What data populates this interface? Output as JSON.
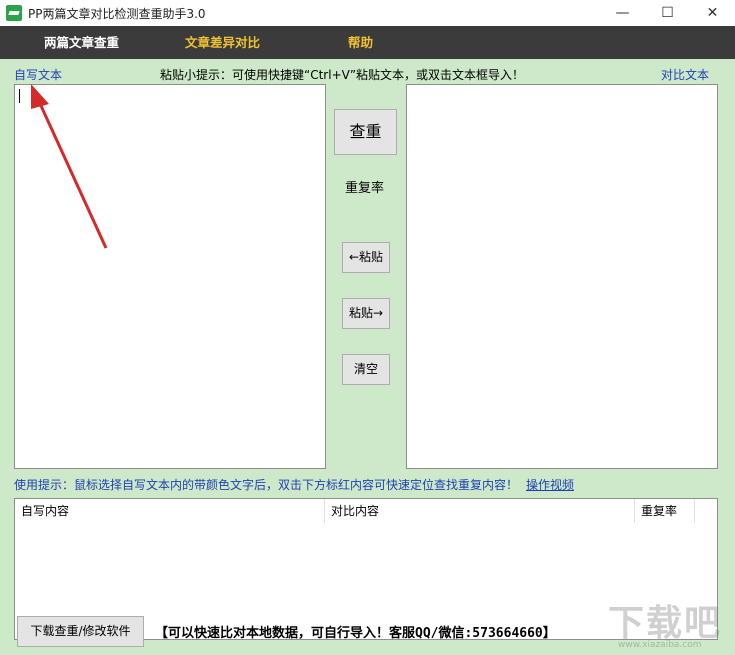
{
  "window": {
    "title": "PP两篇文章对比检测查重助手3.0",
    "minimize": "—",
    "maximize": "☐",
    "close": "✕"
  },
  "menu": {
    "items": [
      {
        "label": "两篇文章查重"
      },
      {
        "label": "文章差异对比"
      },
      {
        "label": "帮助"
      }
    ]
  },
  "top": {
    "left_label": "自写文本",
    "tip": "粘贴小提示：可使用快捷键“Ctrl+V”粘贴文本，或双击文本框导入！",
    "right_label": "对比文本"
  },
  "center": {
    "check_button": "查重",
    "rate_label": "重复率",
    "paste_left": "←粘贴",
    "paste_right": "粘贴→",
    "clear": "清空"
  },
  "hint": {
    "text": "使用提示：鼠标选择自写文本内的带颜色文字后，双击下方标红内容可快速定位查找重复内容！",
    "video_link": "操作视频"
  },
  "results": {
    "columns": [
      "自写内容",
      "对比内容",
      "重复率"
    ]
  },
  "bottom": {
    "download_button": "下载查重/修改软件",
    "note": "【可以快速比对本地数据，可自行导入！客服QQ/微信:573664660】"
  },
  "watermark": {
    "text": "下载吧",
    "sub": "www.xiazaiba.com"
  },
  "colors": {
    "panel_bg": "#cde9c9",
    "menubar_bg": "#3b3b3b",
    "menu_accent": "#f0c232",
    "link": "#1f3fb6",
    "arrow": "#d42a2a"
  }
}
